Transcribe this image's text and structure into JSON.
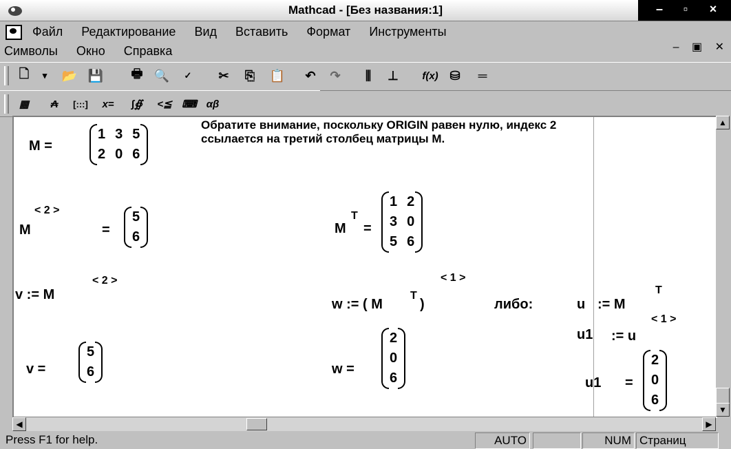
{
  "window": {
    "title": "Mathcad - [Без названия:1]",
    "icon": "mathcad-app-icon"
  },
  "menu": {
    "row1": [
      "Файл",
      "Редактирование",
      "Вид",
      "Вставить",
      "Формат",
      "Инструменты"
    ],
    "row2": [
      "Символы",
      "Окно",
      "Справка"
    ]
  },
  "toolbar_icons": [
    "new-document-icon",
    "dropdown-arrow-icon",
    "open-folder-icon",
    "save-icon",
    "print-icon",
    "print-preview-icon",
    "spell-check-icon",
    "cut-icon",
    "copy-icon",
    "paste-icon",
    "undo-icon",
    "redo-icon",
    "align-across-icon",
    "align-down-icon",
    "insert-function-icon",
    "insert-unit-icon",
    "calculate-icon"
  ],
  "math_palette_icons": [
    "calculator-palette-icon",
    "graph-palette-icon",
    "matrix-palette-icon",
    "evaluation-palette-icon",
    "calculus-palette-icon",
    "boolean-palette-icon",
    "programming-palette-icon",
    "greek-palette-icon"
  ],
  "math_palette_glyphs": [
    "▦",
    "₳",
    "[:::]",
    "x=",
    "∫∯",
    "<≦",
    "⌨",
    "αβ"
  ],
  "worksheet": {
    "note": "Обратите внимание, поскольку ORIGIN равен нулю, индекс 2 ссылается на третий столбец матрицы M.",
    "M_def": {
      "lhs": "M  =",
      "rows": [
        [
          "1",
          "3",
          "5"
        ],
        [
          "2",
          "0",
          "6"
        ]
      ]
    },
    "M_col": {
      "lhs": "M",
      "sup": "< 2 >",
      "eq": "=",
      "rows": [
        [
          "5"
        ],
        [
          "6"
        ]
      ]
    },
    "M_T": {
      "lhs": "M",
      "sup": "T",
      "eq": "=",
      "rows": [
        [
          "1",
          "2"
        ],
        [
          "3",
          "0"
        ],
        [
          "5",
          "6"
        ]
      ]
    },
    "v_def": {
      "lhs": "v  :=  M",
      "sup": "< 2 >"
    },
    "w_def": {
      "lhs": "w  := ( M",
      "sup_inner": "T",
      "close": ")",
      "sup": "< 1 >"
    },
    "or_label": "либо:",
    "u_def": {
      "lhs": "u",
      "assign": ":=  M",
      "sup": "T"
    },
    "u1_def": {
      "lhs": "u1",
      "assign": ":=  u",
      "sup": "< 1 >"
    },
    "v_res": {
      "lhs": "v  =",
      "rows": [
        [
          "5"
        ],
        [
          "6"
        ]
      ]
    },
    "w_res": {
      "lhs": "w  =",
      "rows": [
        [
          "2"
        ],
        [
          "0"
        ],
        [
          "6"
        ]
      ]
    },
    "u1_res": {
      "lhs": "u1",
      "eq": "=",
      "rows": [
        [
          "2"
        ],
        [
          "0"
        ],
        [
          "6"
        ]
      ]
    }
  },
  "status": {
    "help": "Press F1 for help.",
    "mode": "AUTO",
    "num": "NUM",
    "page": "Страниц"
  }
}
